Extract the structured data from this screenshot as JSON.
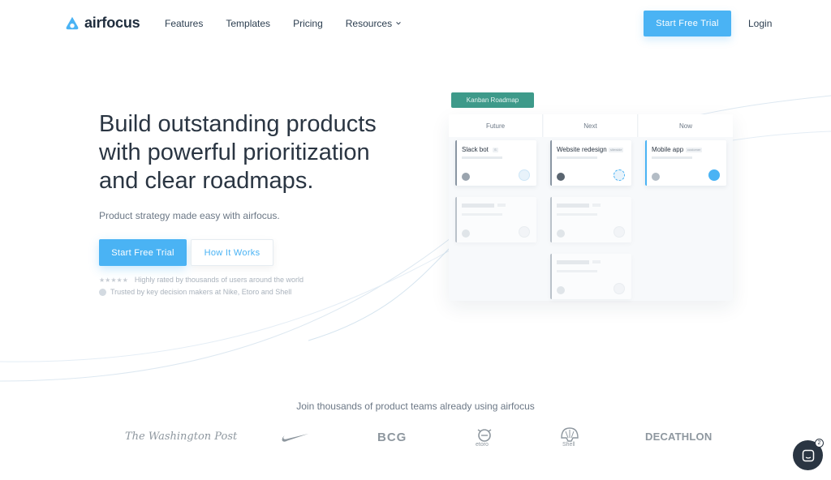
{
  "brand": {
    "name": "airfocus",
    "accent": "#4ab3f4",
    "kanban_color": "#3e9a8a"
  },
  "nav": {
    "items": [
      {
        "label": "Features"
      },
      {
        "label": "Templates"
      },
      {
        "label": "Pricing"
      },
      {
        "label": "Resources",
        "dropdown": true
      }
    ],
    "cta_label": "Start Free Trial",
    "login_label": "Login"
  },
  "hero": {
    "title_line1": "Build outstanding products",
    "title_line2": "with powerful prioritization",
    "title_line3": "and clear roadmaps.",
    "subtitle": "Product strategy made easy with airfocus.",
    "primary_button": "Start Free Trial",
    "secondary_button": "How It Works",
    "rating_text": "Highly rated by thousands of users around the world",
    "trust_text": "Trusted by key decision makers at Nike, Etoro and Shell",
    "stars": "★★★★★"
  },
  "kanban": {
    "label": "Kanban Roadmap",
    "columns": [
      "Future",
      "Next",
      "Now"
    ],
    "cards": [
      {
        "title": "Slack bot",
        "tag": "S"
      },
      {
        "title": "Website redesign",
        "tag": "sitewide"
      },
      {
        "title": "Mobile app",
        "tag": "customer"
      }
    ]
  },
  "logos": {
    "caption": "Join thousands of product teams already using airfocus",
    "washington_post": "The Washington Post",
    "bcg": "BCG",
    "etoro": "etoro",
    "shell": "Shell",
    "decathlon": "DECATHLON"
  },
  "chat": {
    "badge": "2"
  }
}
